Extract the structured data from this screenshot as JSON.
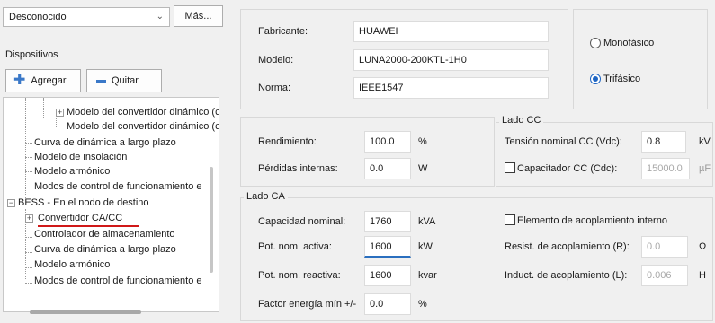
{
  "left": {
    "combo_value": "Desconocido",
    "more_button": "Más...",
    "section_label": "Dispositivos",
    "add_button": "Agregar",
    "remove_button": "Quitar",
    "tree": [
      "Modelo del convertidor dinámico (c",
      "Modelo del convertidor dinámico (c",
      "Curva de dinámica a largo plazo",
      "Modelo de insolación",
      "Modelo armónico",
      "Modos de control de funcionamiento e",
      "BESS - En el nodo de destino",
      "Convertidor CA/CC",
      "Controlador de almacenamiento",
      "Curva de dinámica a largo plazo",
      "Modelo armónico",
      "Modos de control de funcionamiento e"
    ]
  },
  "device": {
    "manufacturer_label": "Fabricante:",
    "manufacturer_value": "HUAWEI",
    "model_label": "Modelo:",
    "model_value": "LUNA2000-200KTL-1H0",
    "standard_label": "Norma:",
    "standard_value": "IEEE1547"
  },
  "phase": {
    "mono_label": "Monofásico",
    "tri_label": "Trifásico",
    "selected": "tri"
  },
  "efficiency": {
    "eff_label": "Rendimiento:",
    "eff_value": "100.0",
    "eff_unit": "%",
    "loss_label": "Pérdidas internas:",
    "loss_value": "0.0",
    "loss_unit": "W"
  },
  "dc": {
    "group_title": "Lado CC",
    "vdc_label": "Tensión nominal CC (Vdc):",
    "vdc_value": "0.8",
    "vdc_unit": "kV",
    "cap_label": "Capacitador CC (Cdc):",
    "cap_value": "15000.0",
    "cap_unit": "µF"
  },
  "ac": {
    "group_title": "Lado CA",
    "cap_nom_label": "Capacidad nominal:",
    "cap_nom_value": "1760",
    "cap_nom_unit": "kVA",
    "p_active_label": "Pot. nom. activa:",
    "p_active_value": "1600",
    "p_active_unit": "kW",
    "p_reactive_label": "Pot. nom. reactiva:",
    "p_reactive_value": "1600",
    "p_reactive_unit": "kvar",
    "pf_label": "Factor energía mín  +/-",
    "pf_value": "0.0",
    "pf_unit": "%",
    "coupling_label": "Elemento de acoplamiento interno",
    "r_label": "Resist. de acoplamiento (R):",
    "r_value": "0.0",
    "r_unit": "Ω",
    "l_label": "Induct. de acoplamiento (L):",
    "l_value": "0.006",
    "l_unit": "H"
  },
  "colors": {
    "accent": "#1f66c4",
    "underline": "#d01818"
  }
}
